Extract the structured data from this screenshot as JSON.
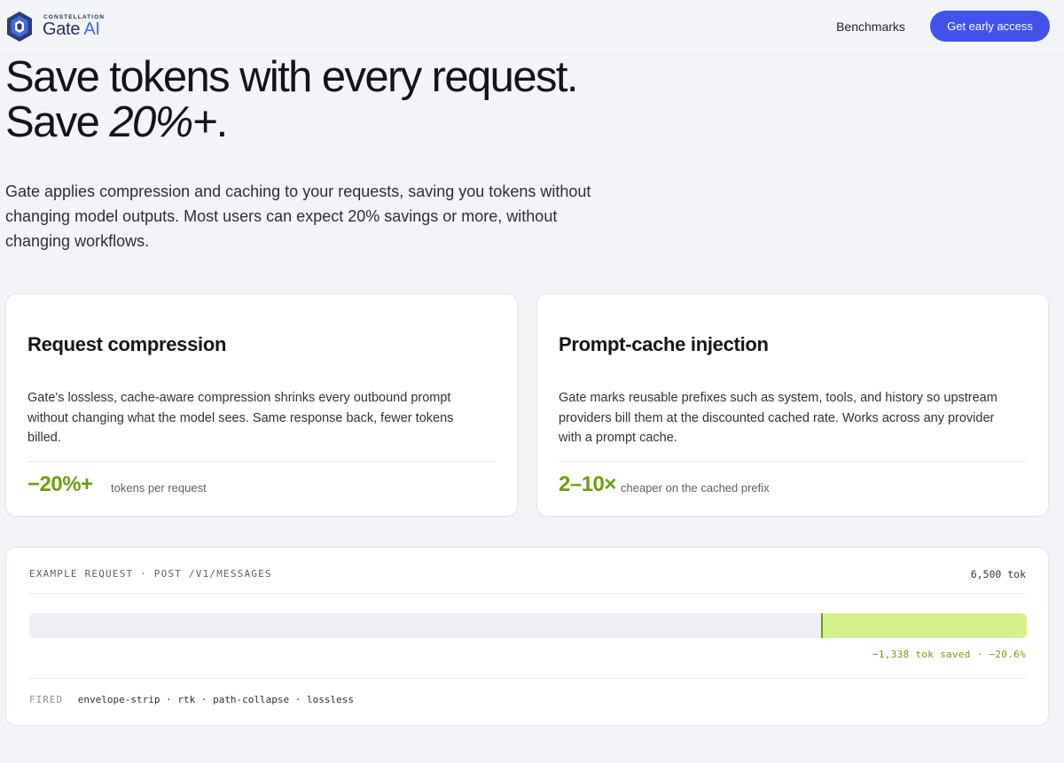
{
  "header": {
    "logo_sub": "CONSTELLATION",
    "logo_name": "Gate",
    "logo_name_accent": "AI",
    "nav_link": "Benchmarks",
    "cta_label": "Get early access"
  },
  "hero": {
    "title_line1": "Save tokens with every request.",
    "title_line2_prefix": "Save ",
    "title_line2_accent": "20%+",
    "title_line2_suffix": ".",
    "description": "Gate applies compression and caching to your requests, saving you tokens without changing model outputs. Most users can expect 20% savings or more, without changing workflows."
  },
  "features": [
    {
      "title": "Request compression",
      "text": "Gate's lossless, cache-aware compression shrinks every outbound prompt without changing what the model sees. Same response back, fewer tokens billed.",
      "stat": "−20%+",
      "stat_label": "tokens per request"
    },
    {
      "title": "Prompt-cache injection",
      "text": "Gate marks reusable prefixes such as system, tools, and history so upstream providers bill them at the discounted cached rate. Works across any provider with a prompt cache.",
      "stat": "2–10×",
      "stat_label": "cheaper on the cached prefix"
    }
  ],
  "example": {
    "label": "EXAMPLE REQUEST · POST /V1/MESSAGES",
    "total": "6,500 tok",
    "total_tokens": 6500,
    "saved_tokens": 1338,
    "saved_text": "−1,338 tok saved · −20.6%",
    "fired_label": "FIRED",
    "fired_items": "envelope-strip · rtk · path-collapse · lossless"
  },
  "colors": {
    "brand": "#4152ec",
    "accent_green": "#6e9d12",
    "saved_bar": "#d4f08a",
    "logo_navy": "#22315c"
  }
}
